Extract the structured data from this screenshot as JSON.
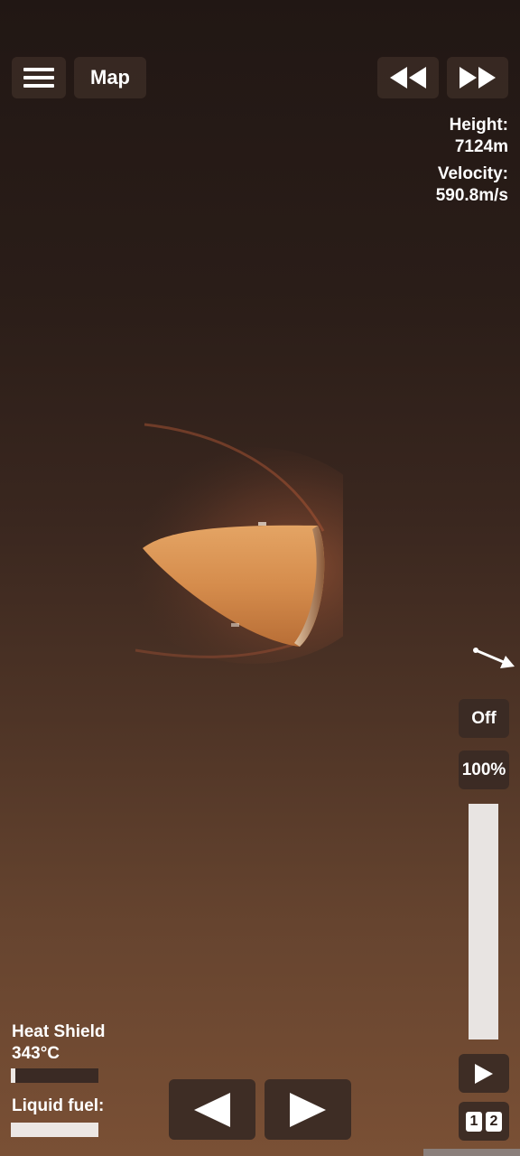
{
  "top_bar": {
    "menu_icon": "hamburger-menu-icon",
    "map_label": "Map",
    "rewind_icon": "rewind-icon",
    "fast_forward_icon": "fast-forward-icon"
  },
  "flight_info": {
    "height_label": "Height:",
    "height_value": "7124m",
    "velocity_label": "Velocity:",
    "velocity_value": "590.8m/s"
  },
  "controls": {
    "sas_label": "Off",
    "throttle_label": "100%",
    "throttle_level": 1.0,
    "play_icon": "play-icon",
    "stage_digits": [
      "1",
      "2"
    ],
    "rotate_left_icon": "rotate-left-icon",
    "rotate_right_icon": "rotate-right-icon"
  },
  "resources": {
    "heat_shield_label": "Heat Shield",
    "heat_shield_value": "343°C",
    "heat_shield_level": 0.05,
    "liquid_fuel_label": "Liquid fuel:",
    "liquid_fuel_level": 1.0
  },
  "colors": {
    "button_bg": "#3a2a24",
    "capsule": "#d8914f",
    "plasma": "#b45a37"
  }
}
